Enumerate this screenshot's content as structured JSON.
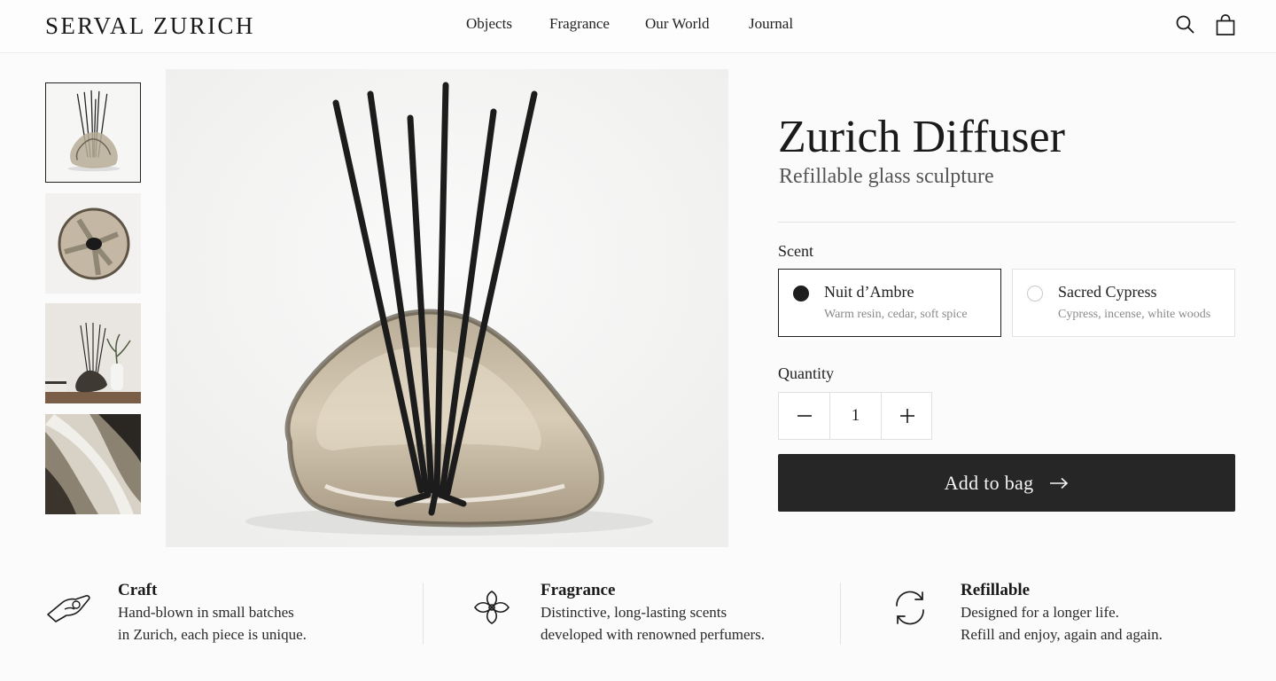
{
  "header": {
    "logo": "SERVAL ZURICH",
    "nav": [
      "Objects",
      "Fragrance",
      "Our World",
      "Journal"
    ],
    "icons": [
      "search-icon",
      "shopping-bag-icon"
    ]
  },
  "gallery": {
    "thumbnails": [
      "diffuser-front-view",
      "diffuser-top-view",
      "diffuser-in-room",
      "glass-detail"
    ],
    "selected_index": 0
  },
  "product": {
    "title": "Zurich Diffuser",
    "subtitle": "Refillable glass sculpture",
    "scent_label": "Scent",
    "scents": [
      {
        "name": "Nuit d’Ambre",
        "notes": "Warm resin, cedar, soft spice",
        "selected": true
      },
      {
        "name": "Sacred Cypress",
        "notes": "Cypress, incense, white woods",
        "selected": false
      }
    ],
    "quantity_label": "Quantity",
    "quantity": "1",
    "add_to_bag": "Add to bag"
  },
  "features": [
    {
      "icon": "hand-craft-icon",
      "title": "Craft",
      "lines": [
        "Hand-blown in small batches",
        "in Zurich, each piece is unique."
      ]
    },
    {
      "icon": "flower-icon",
      "title": "Fragrance",
      "lines": [
        "Distinctive, long-lasting scents",
        "developed with renowned perfumers."
      ]
    },
    {
      "icon": "refill-cycle-icon",
      "title": "Refillable",
      "lines": [
        "Designed for a longer life.",
        "Refill and enjoy, again and again."
      ]
    }
  ],
  "colors": {
    "primary_button": "#262626",
    "text": "#1c1c1c",
    "muted": "#8a8a8a",
    "border": "#e2e2e2"
  }
}
